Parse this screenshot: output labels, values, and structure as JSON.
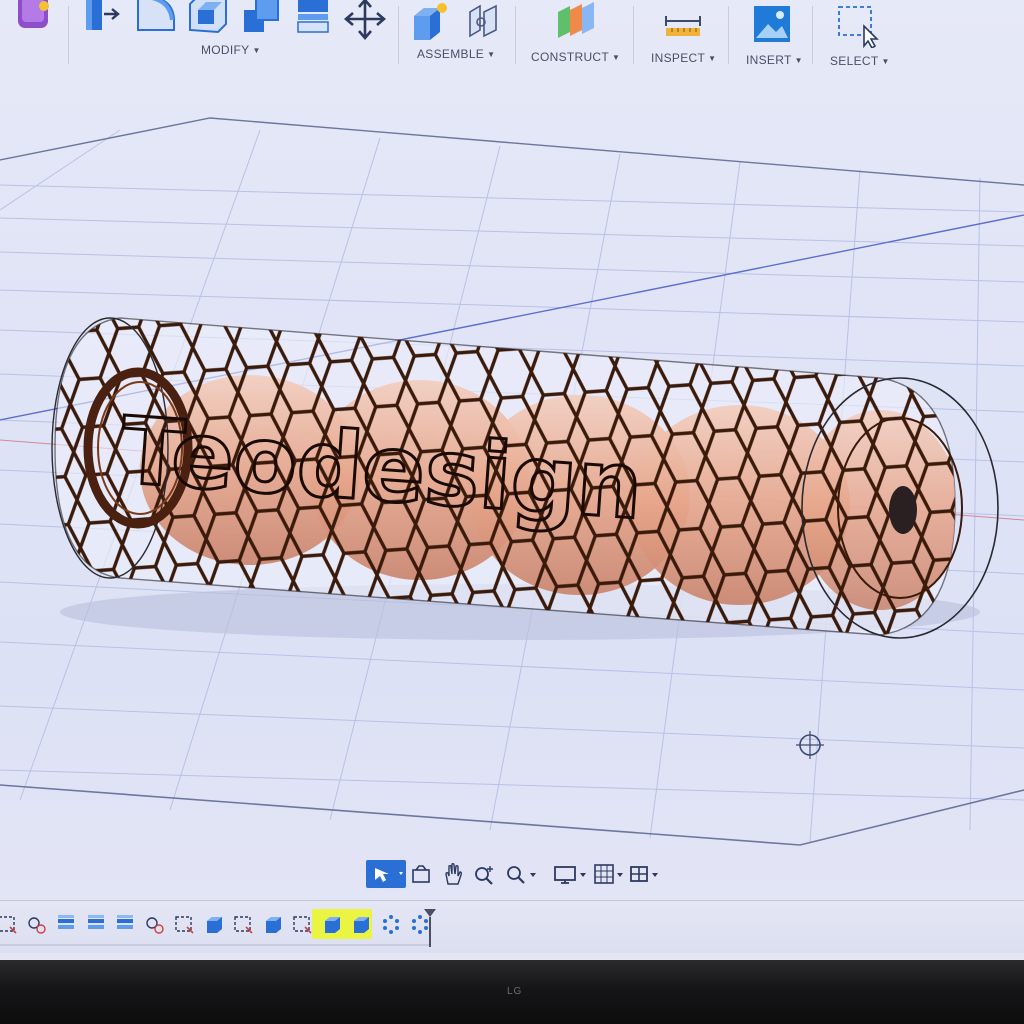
{
  "toolbar": {
    "groups": [
      {
        "label": "MODIFY"
      },
      {
        "label": "ASSEMBLE"
      },
      {
        "label": "CONSTRUCT"
      },
      {
        "label": "INSPECT"
      },
      {
        "label": "INSERT"
      },
      {
        "label": "SELECT"
      }
    ]
  },
  "model": {
    "embossed_text": "Teodesign"
  },
  "navbar": {
    "icons": [
      "orbit-icon",
      "look-at-icon",
      "pan-icon",
      "zoom-window-icon",
      "zoom-icon",
      "display-settings-icon",
      "grid-settings-icon",
      "viewports-icon"
    ]
  },
  "timeline": {
    "icons": [
      "sketch",
      "joint",
      "extrude",
      "extrude",
      "extrude",
      "joint",
      "sketch",
      "body",
      "sketch",
      "body",
      "sketch",
      "body-highlighted",
      "body-highlighted",
      "pattern",
      "pattern",
      "marker"
    ]
  },
  "monitor": {
    "brand": "LG"
  },
  "colors": {
    "grid_line": "#b9c2e6",
    "body_fill": "#e7a98f",
    "lattice": "#3a1a0a",
    "accent_blue": "#2a6fd6",
    "highlight": "#e9f542"
  }
}
